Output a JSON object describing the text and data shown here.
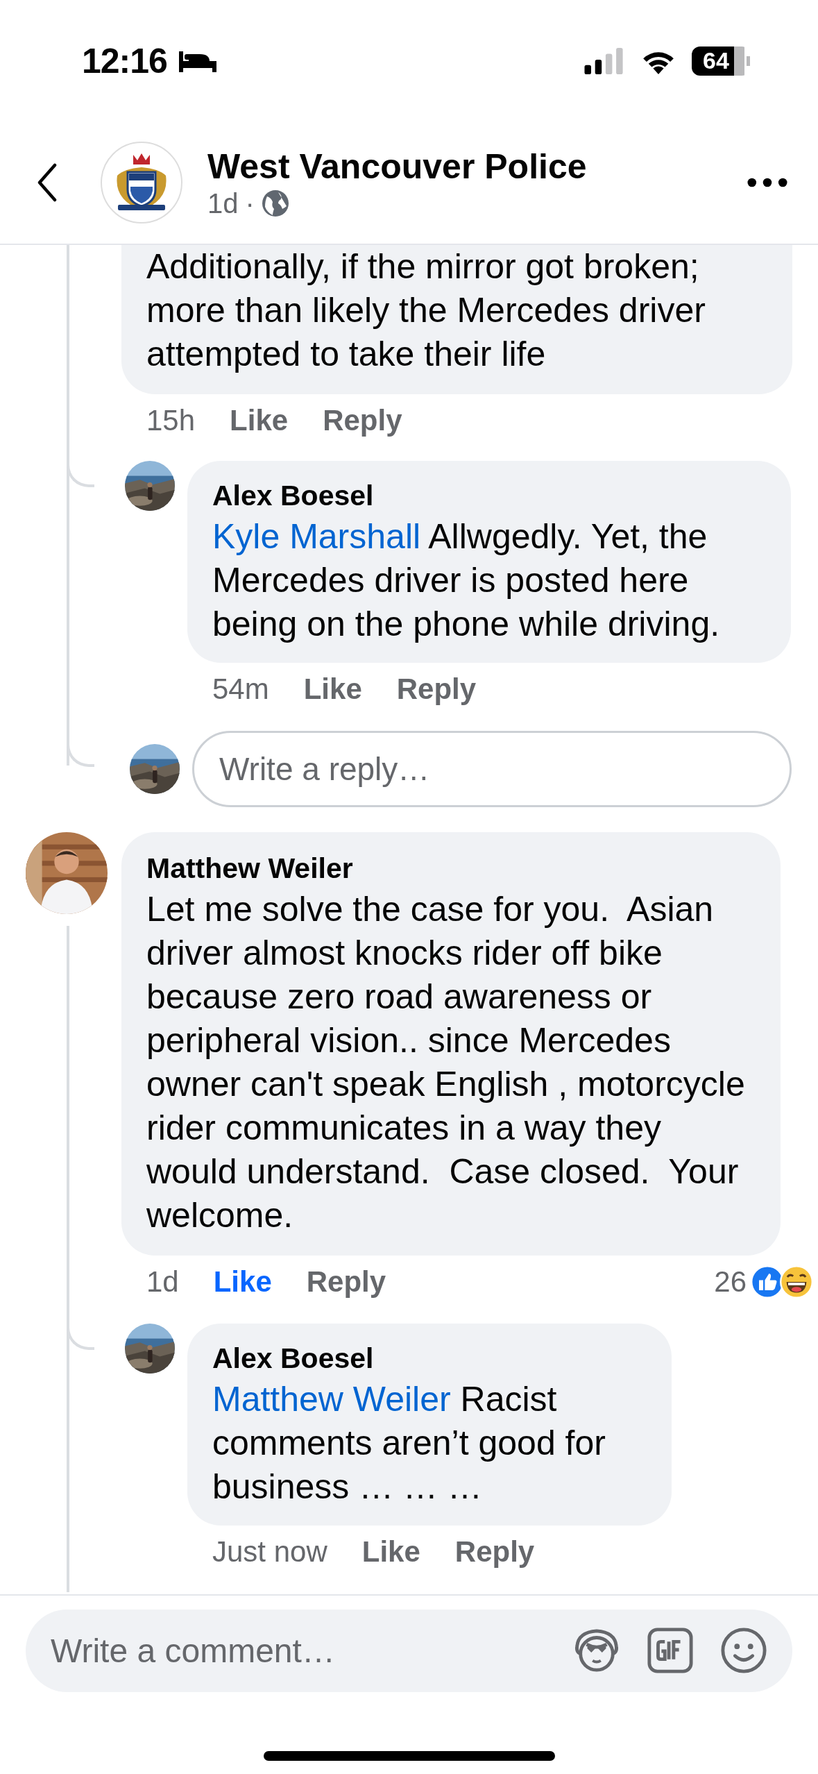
{
  "status_bar": {
    "time": "12:16",
    "battery": "64"
  },
  "header": {
    "title": "West Vancouver Police",
    "age": "1d",
    "separator": "·"
  },
  "threads": [
    {
      "comment": {
        "text": "Additionally, if the mirror got broken; more than likely the Mercedes driver attempted to take their life",
        "time": "15h",
        "like": "Like",
        "reply": "Reply",
        "liked": false
      },
      "replies": [
        {
          "author": "Alex Boesel",
          "mention": "Kyle Marshall",
          "text": "Allwgedly. Yet, the Mercedes driver is posted here being on the phone while driving.",
          "time": "54m",
          "like": "Like",
          "reply": "Reply",
          "liked": false
        }
      ],
      "reply_box": {
        "placeholder": "Write a reply…"
      }
    },
    {
      "comment": {
        "author": "Matthew Weiler",
        "text": "Let me solve the case for you.  Asian driver almost knocks rider off bike because zero road awareness or peripheral vision.. since Mercedes owner can't speak English , motorcycle rider communicates in a way they would understand.  Case closed.  Your welcome.",
        "time": "1d",
        "like": "Like",
        "reply": "Reply",
        "liked": true,
        "reaction_count": "26"
      },
      "replies": [
        {
          "author": "Alex Boesel",
          "mention": "Matthew Weiler",
          "text": "Racist comments aren’t good for business … … …",
          "time": "Just now",
          "like": "Like",
          "reply": "Reply",
          "liked": false
        }
      ]
    }
  ],
  "composer": {
    "placeholder": "Write a comment…"
  }
}
